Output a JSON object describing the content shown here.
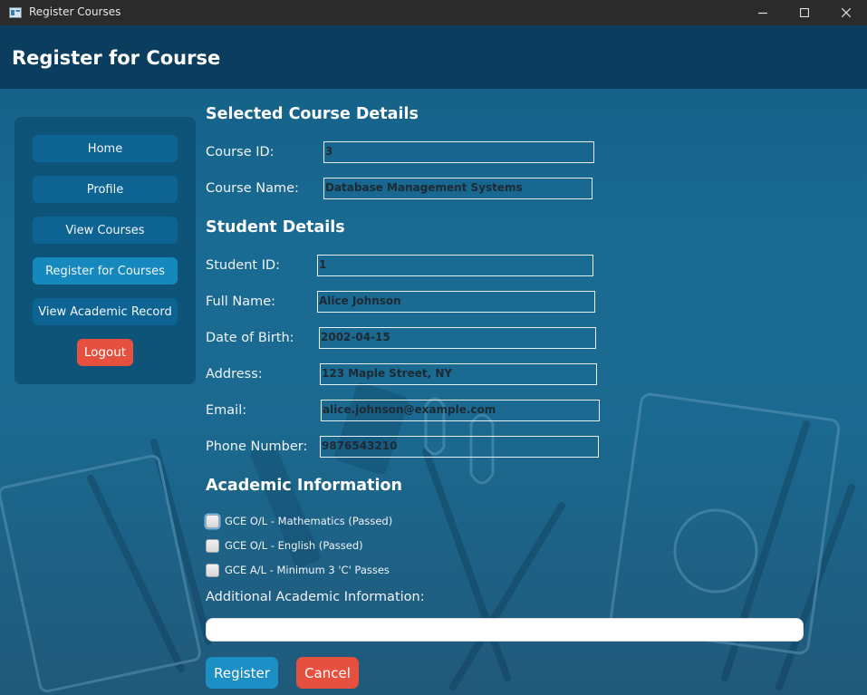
{
  "window": {
    "title": "Register Courses",
    "icons": {
      "app": "app-window-icon",
      "minimize": "minimize-icon",
      "maximize": "maximize-icon",
      "close": "close-icon"
    }
  },
  "header": {
    "title": "Register for Course"
  },
  "sidebar": {
    "items": [
      {
        "label": "Home"
      },
      {
        "label": "Profile"
      },
      {
        "label": "View Courses"
      },
      {
        "label": "Register for Courses",
        "active": true
      },
      {
        "label": "View Academic Record"
      }
    ],
    "logout_label": "Logout"
  },
  "course": {
    "section_title": "Selected Course Details",
    "id_label": "Course ID:",
    "id_value": "3",
    "name_label": "Course Name:",
    "name_value": "Database Management Systems"
  },
  "student": {
    "section_title": "Student Details",
    "id_label": "Student ID:",
    "id_value": "1",
    "name_label": "Full Name:",
    "name_value": "Alice Johnson",
    "dob_label": "Date of Birth:",
    "dob_value": "2002-04-15",
    "address_label": "Address:",
    "address_value": "123 Maple Street, NY",
    "email_label": "Email:",
    "email_value": "alice.johnson@example.com",
    "phone_label": "Phone Number:",
    "phone_value": "9876543210"
  },
  "academic": {
    "section_title": "Academic Information",
    "checks": [
      {
        "label": "GCE O/L - Mathematics (Passed)",
        "checked": false
      },
      {
        "label": "GCE O/L - English (Passed)",
        "checked": false
      },
      {
        "label": "GCE A/L - Minimum 3 'C' Passes",
        "checked": false
      }
    ],
    "additional_label": "Additional Academic Information:",
    "additional_value": ""
  },
  "actions": {
    "register_label": "Register",
    "cancel_label": "Cancel"
  },
  "colors": {
    "header": "#0b3e5e",
    "sidebar": "#0e5378",
    "nav_button": "#0d6493",
    "nav_active": "#1588bd",
    "register": "#1c8fc6",
    "danger": "#e5503f"
  }
}
